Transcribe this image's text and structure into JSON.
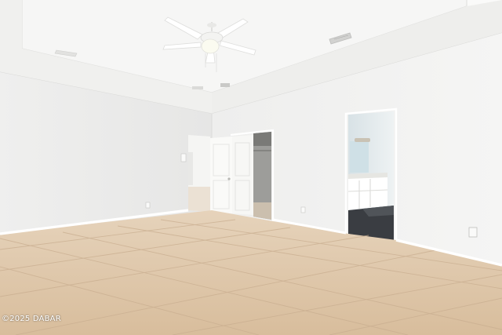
{
  "photo": {
    "watermark": "©2025 DABAR",
    "colors": {
      "ceiling": "#f7f7f6",
      "wall_left": "#ededec",
      "wall_right": "#f3f3f2",
      "floor": "#dcc4a7",
      "grout": "#c9ae90",
      "baseboard": "#ffffff",
      "door": "#f7f7f5",
      "closet_interior": "#9d9d9a",
      "bath_wall": "#dfe7ea",
      "bath_floor": "#3a3d42"
    },
    "icons": [
      "ceiling-fan-icon",
      "air-vent-icon",
      "outlet-icon",
      "light-switch-icon"
    ]
  }
}
